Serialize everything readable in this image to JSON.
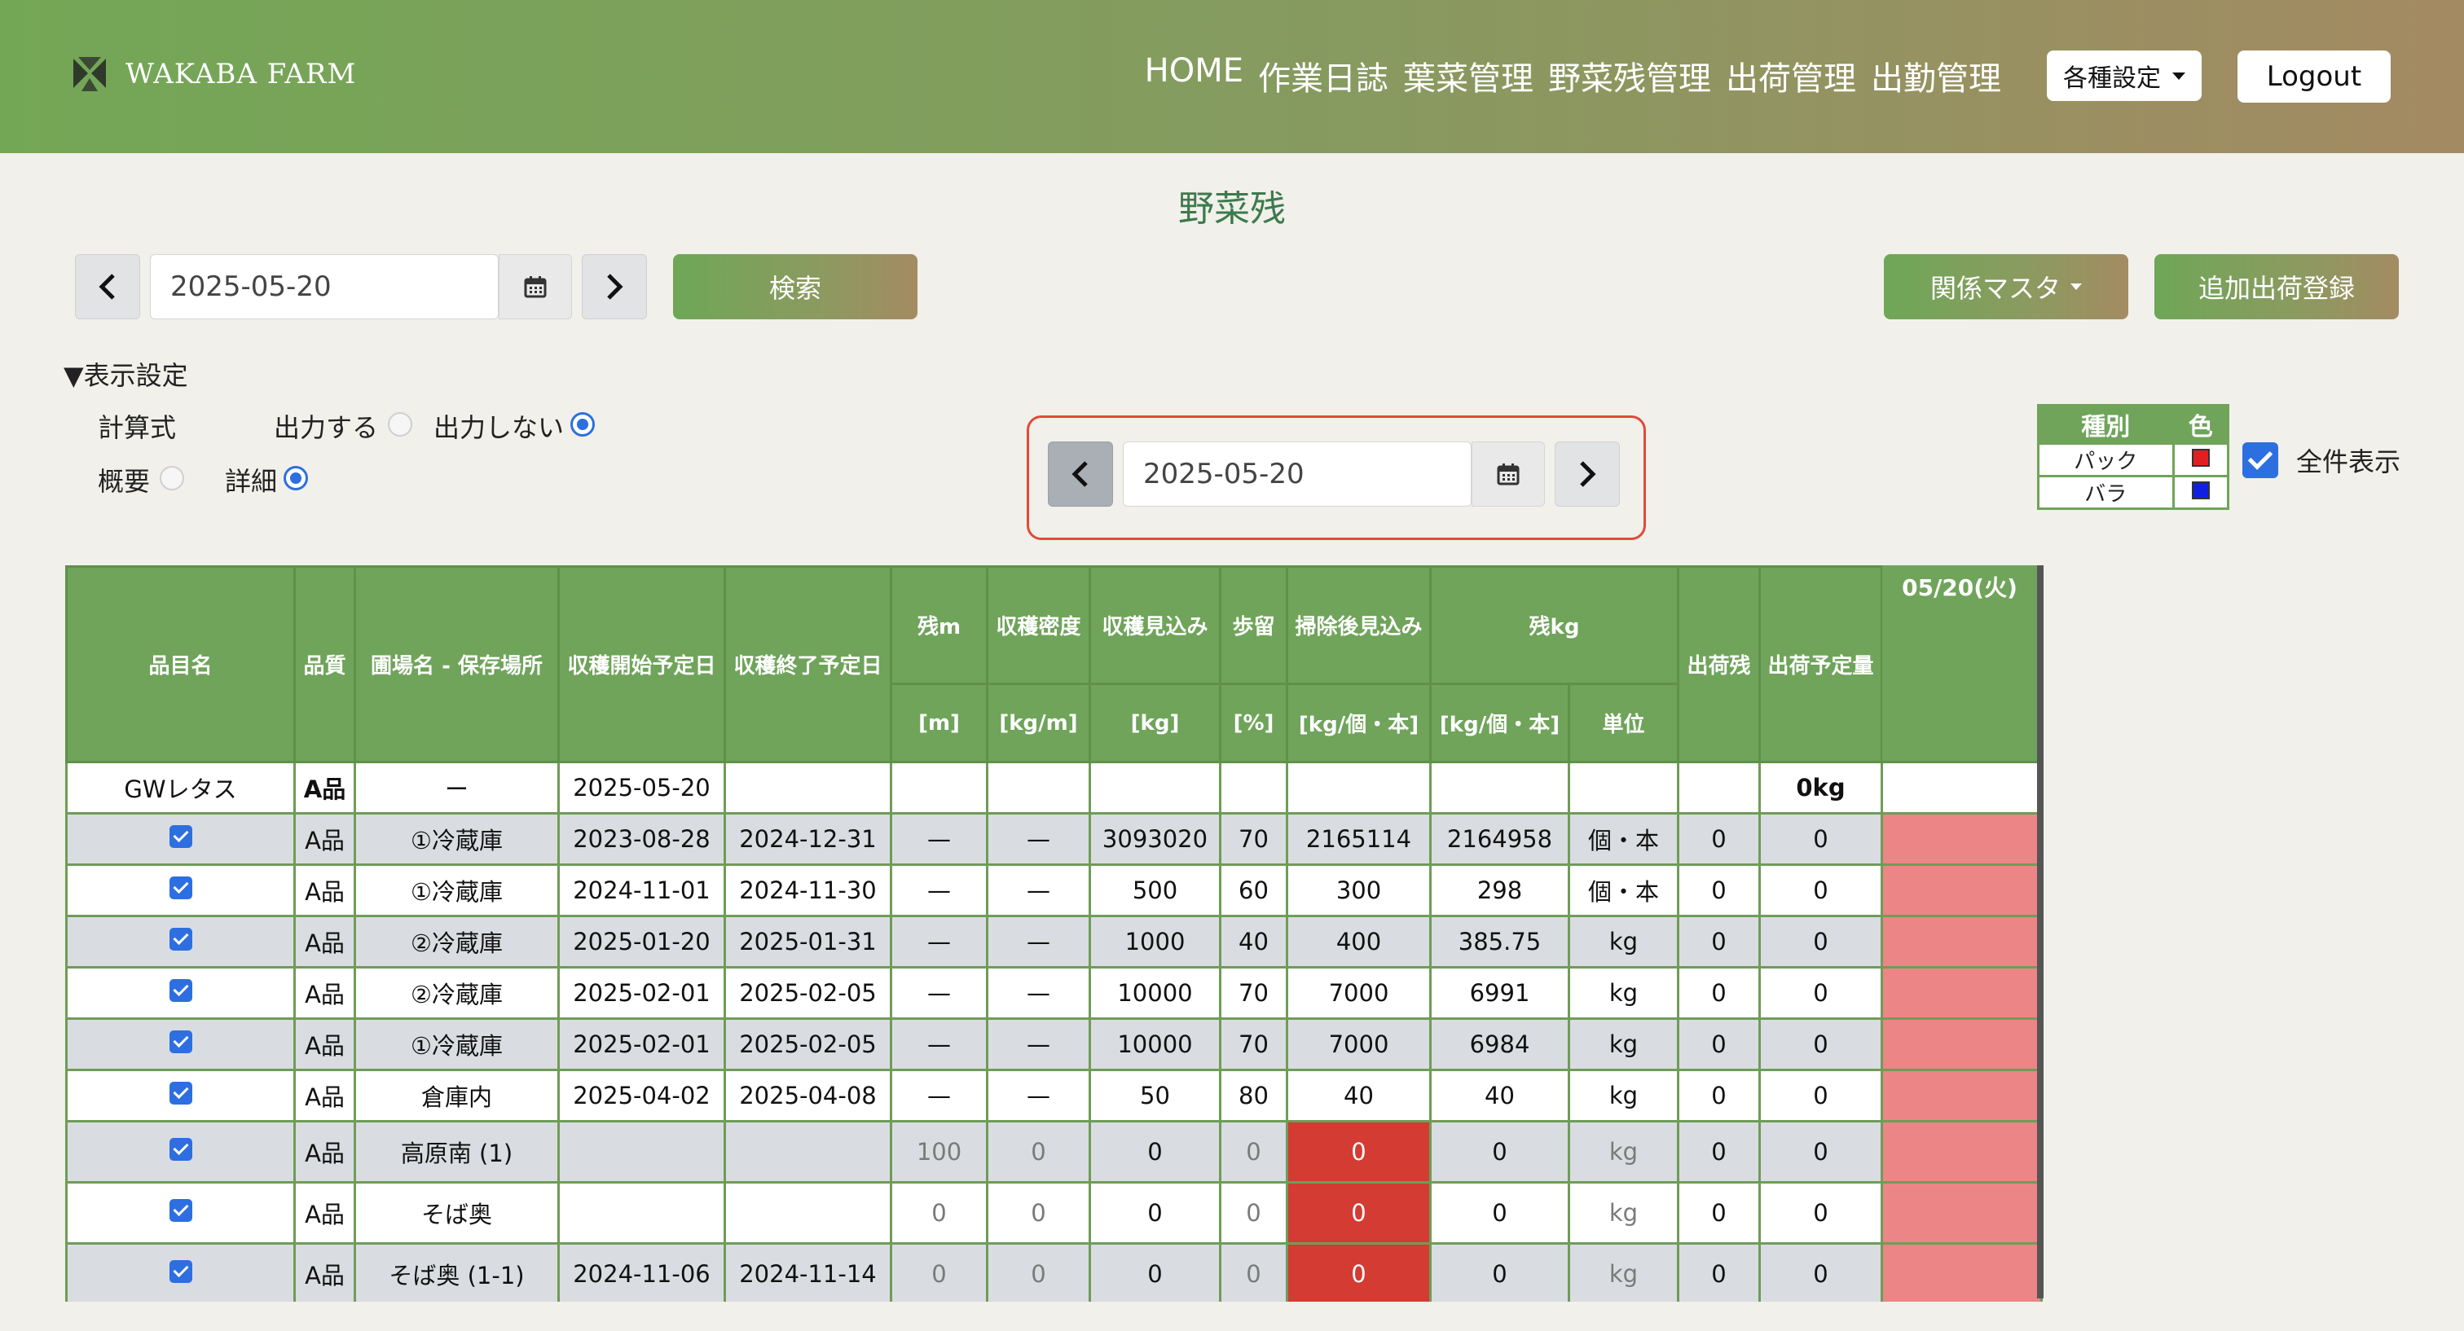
{
  "header": {
    "logo_text": "WAKABA FARM",
    "nav": [
      "HOME",
      "作業日誌",
      "葉菜管理",
      "野菜残管理",
      "出荷管理",
      "出勤管理"
    ],
    "settings_label": "各種設定",
    "logout_label": "Logout"
  },
  "page_title": "野菜残",
  "search": {
    "date": "2025-05-20",
    "search_label": "検索",
    "master_label": "関係マスタ",
    "add_shipment_label": "追加出荷登録"
  },
  "display_settings": {
    "title": "▼表示設定",
    "formula_label": "計算式",
    "output_yes": "出力する",
    "output_no": "出力しない",
    "overview": "概要",
    "detail": "詳細",
    "output_selected": "出力しない",
    "view_selected": "詳細"
  },
  "secondary_date": "2025-05-20",
  "legend": {
    "headers": [
      "種別",
      "色"
    ],
    "rows": [
      {
        "label": "パック",
        "color": "#e02020"
      },
      {
        "label": "バラ",
        "color": "#1020e0"
      }
    ]
  },
  "show_all": {
    "label": "全件表示",
    "checked": true
  },
  "table": {
    "date_column": "05/20(火)",
    "headers": {
      "item": "品目名",
      "quality": "品質",
      "field": "圃場名 - 保存場所",
      "start": "収穫開始予定日",
      "end": "収穫終了予定日",
      "remain_m": "残m",
      "density": "収穫密度",
      "expected": "収穫見込み",
      "yield": "歩留",
      "after_clean": "掃除後見込み",
      "remain_kg": "残kg",
      "shipped": "出荷残",
      "planned": "出荷予定量"
    },
    "units": {
      "remain_m": "[m]",
      "density": "[kg/m]",
      "expected": "[kg]",
      "yield": "[%]",
      "after_clean": "[kg/個・本]",
      "remain_kg": "[kg/個・本]",
      "unit": "単位"
    },
    "group_row": {
      "item": "GWレタス",
      "quality": "A品",
      "field": "ー",
      "start": "2025-05-20",
      "planned": "0kg"
    },
    "rows": [
      {
        "quality": "A品",
        "field": "①冷蔵庫",
        "start": "2023-08-28",
        "end": "2024-12-31",
        "remain_m": "—",
        "density": "—",
        "expected": "3093020",
        "yield": "70",
        "after_clean": "2165114",
        "remain_kg": "2164958",
        "unit": "個・本",
        "shipped": "0",
        "planned": "0"
      },
      {
        "quality": "A品",
        "field": "①冷蔵庫",
        "start": "2024-11-01",
        "end": "2024-11-30",
        "remain_m": "—",
        "density": "—",
        "expected": "500",
        "yield": "60",
        "after_clean": "300",
        "remain_kg": "298",
        "unit": "個・本",
        "shipped": "0",
        "planned": "0"
      },
      {
        "quality": "A品",
        "field": "②冷蔵庫",
        "start": "2025-01-20",
        "end": "2025-01-31",
        "remain_m": "—",
        "density": "—",
        "expected": "1000",
        "yield": "40",
        "after_clean": "400",
        "remain_kg": "385.75",
        "unit": "kg",
        "shipped": "0",
        "planned": "0"
      },
      {
        "quality": "A品",
        "field": "②冷蔵庫",
        "start": "2025-02-01",
        "end": "2025-02-05",
        "remain_m": "—",
        "density": "—",
        "expected": "10000",
        "yield": "70",
        "after_clean": "7000",
        "remain_kg": "6991",
        "unit": "kg",
        "shipped": "0",
        "planned": "0"
      },
      {
        "quality": "A品",
        "field": "①冷蔵庫",
        "start": "2025-02-01",
        "end": "2025-02-05",
        "remain_m": "—",
        "density": "—",
        "expected": "10000",
        "yield": "70",
        "after_clean": "7000",
        "remain_kg": "6984",
        "unit": "kg",
        "shipped": "0",
        "planned": "0"
      },
      {
        "quality": "A品",
        "field": "倉庫内",
        "start": "2025-04-02",
        "end": "2025-04-08",
        "remain_m": "—",
        "density": "—",
        "expected": "50",
        "yield": "80",
        "after_clean": "40",
        "remain_kg": "40",
        "unit": "kg",
        "shipped": "0",
        "planned": "0"
      },
      {
        "quality": "A品",
        "field": "高原南 (1)",
        "start": "",
        "end": "",
        "remain_m": "100",
        "density": "0",
        "expected": "0",
        "yield": "0",
        "after_clean": "0",
        "remain_kg": "0",
        "unit": "kg",
        "shipped": "0",
        "planned": "0"
      },
      {
        "quality": "A品",
        "field": "そば奥",
        "start": "",
        "end": "",
        "remain_m": "0",
        "density": "0",
        "expected": "0",
        "yield": "0",
        "after_clean": "0",
        "remain_kg": "0",
        "unit": "kg",
        "shipped": "0",
        "planned": "0"
      },
      {
        "quality": "A品",
        "field": "そば奥 (1-1)",
        "start": "2024-11-06",
        "end": "2024-11-14",
        "remain_m": "0",
        "density": "0",
        "expected": "0",
        "yield": "0",
        "after_clean": "0",
        "remain_kg": "0",
        "unit": "kg",
        "shipped": "0",
        "planned": "0"
      }
    ]
  }
}
